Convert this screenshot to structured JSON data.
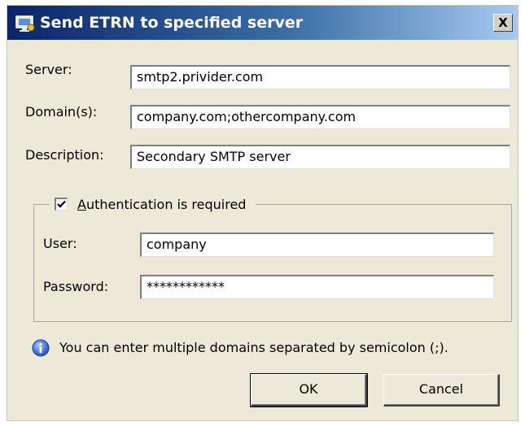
{
  "window": {
    "title": "Send ETRN to specified server",
    "close_glyph": "X"
  },
  "form": {
    "server_label": "Server:",
    "server_value": "smtp2.privider.com",
    "domains_label": "Domain(s):",
    "domains_value": "company.com;othercompany.com",
    "description_label": "Description:",
    "description_value": "Secondary SMTP server"
  },
  "auth": {
    "checkbox_checked": true,
    "checkbox_label_accel": "A",
    "checkbox_label_rest": "uthentication is required",
    "user_label": "User:",
    "user_value": "company",
    "password_label": "Password:",
    "password_value": "************"
  },
  "info": {
    "icon": "info-icon",
    "text": "You can enter multiple domains separated by semicolon (;)."
  },
  "buttons": {
    "ok": "OK",
    "cancel": "Cancel"
  }
}
